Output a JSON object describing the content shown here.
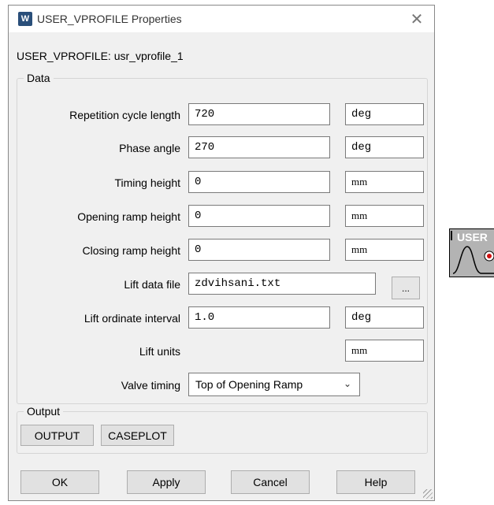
{
  "window": {
    "title": "USER_VPROFILE Properties",
    "app_icon_text": "W"
  },
  "header": {
    "label": "USER_VPROFILE: usr_vprofile_1"
  },
  "data_group": {
    "legend": "Data",
    "rows": [
      {
        "label": "Repetition cycle length",
        "value": "720",
        "unit": "deg"
      },
      {
        "label": "Phase angle",
        "value": "270",
        "unit": "deg"
      },
      {
        "label": "Timing height",
        "value": "0",
        "unit": "mm"
      },
      {
        "label": "Opening ramp height",
        "value": "0",
        "unit": "mm"
      },
      {
        "label": "Closing ramp height",
        "value": "0",
        "unit": "mm"
      },
      {
        "label": "Lift data file",
        "value": "zdvihsani.txt",
        "browse_label": "..."
      },
      {
        "label": "Lift ordinate interval",
        "value": "1.0",
        "unit": "deg"
      },
      {
        "label": "Lift units",
        "unit": "mm"
      },
      {
        "label": "Valve timing",
        "selected": "Top of Opening Ramp"
      }
    ]
  },
  "output_group": {
    "legend": "Output",
    "buttons": [
      "OUTPUT",
      "CASEPLOT"
    ]
  },
  "buttons": {
    "ok": "OK",
    "apply": "Apply",
    "cancel": "Cancel",
    "help": "Help"
  },
  "side_icon": {
    "label": "USER"
  }
}
